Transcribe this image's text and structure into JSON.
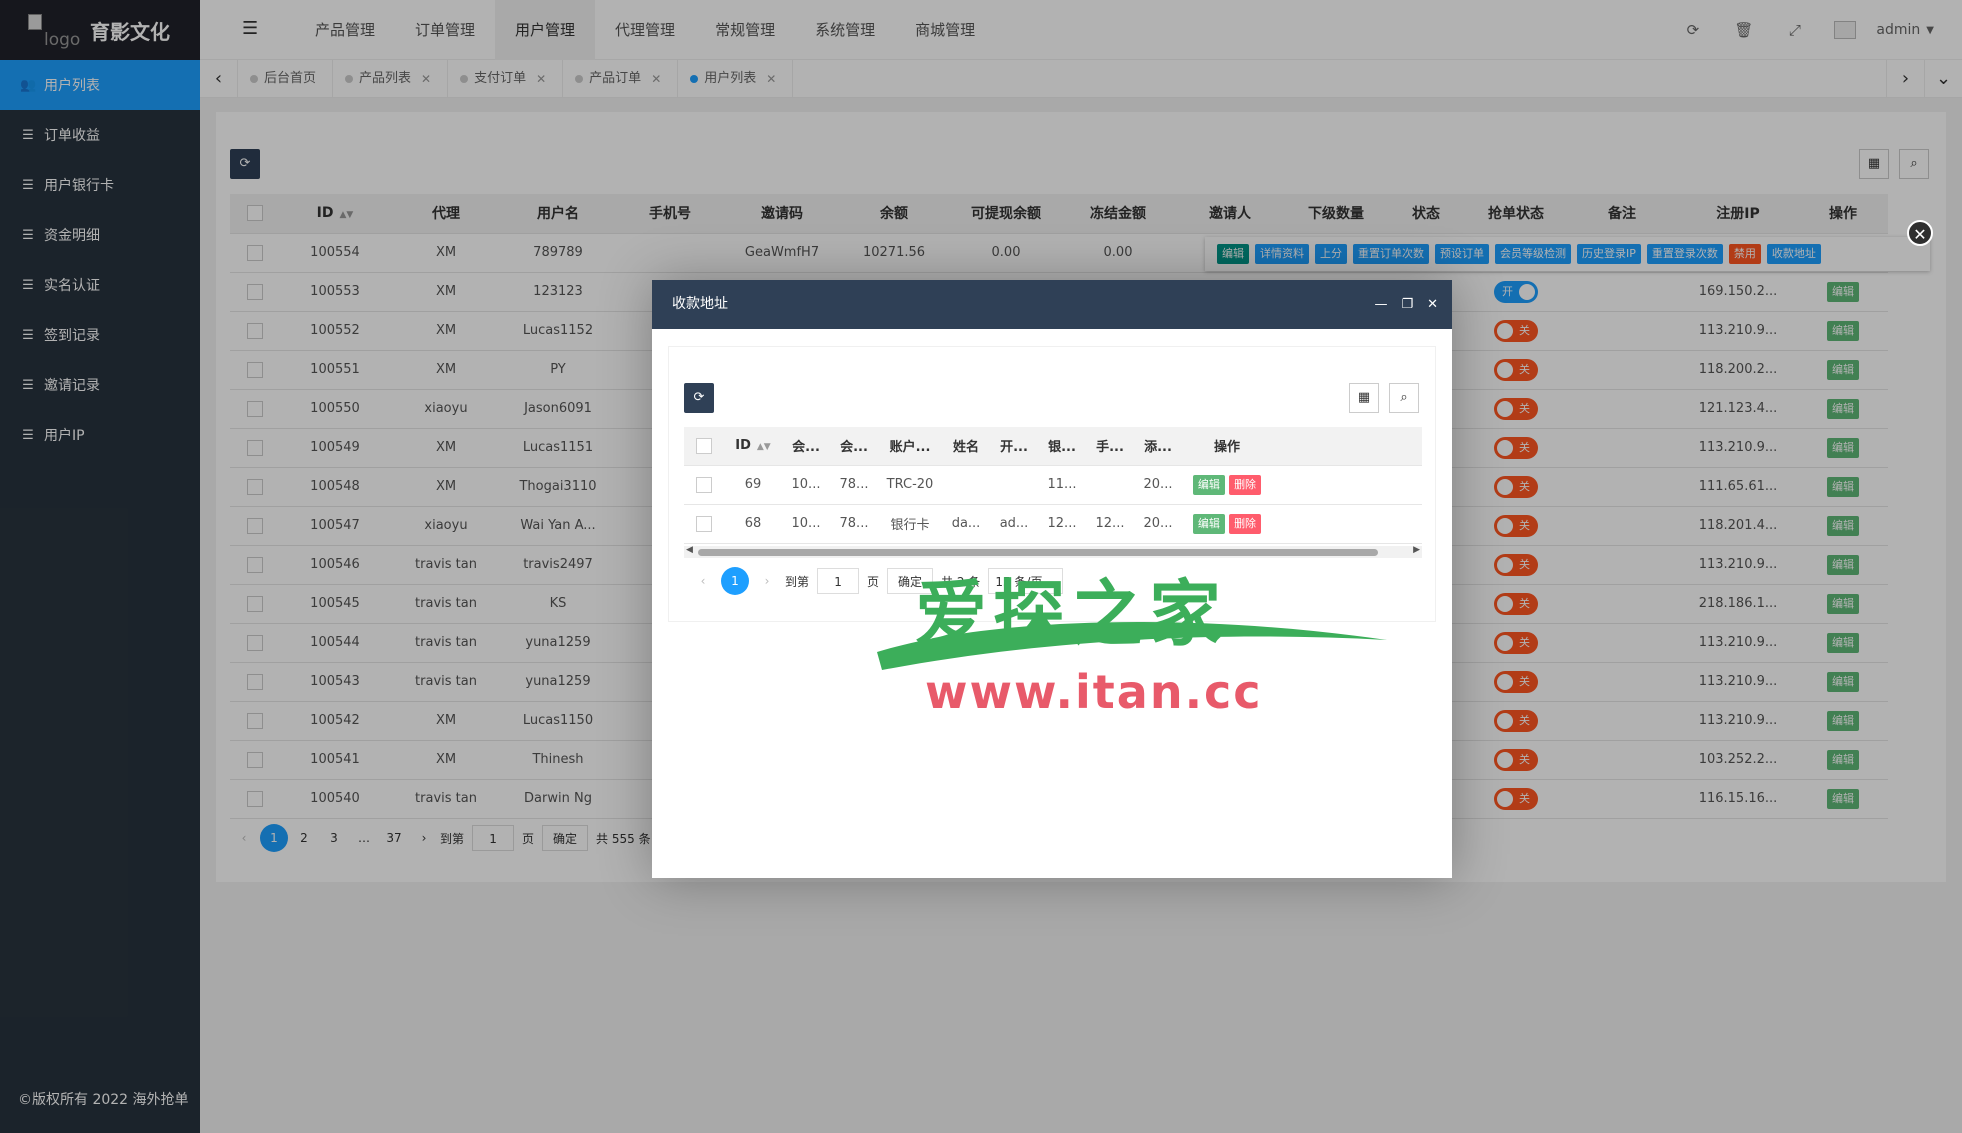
{
  "brand": {
    "logo_alt": "logo",
    "name": "育影文化"
  },
  "sidebar": {
    "items": [
      {
        "label": "用户列表",
        "active": true
      },
      {
        "label": "订单收益"
      },
      {
        "label": "用户银行卡"
      },
      {
        "label": "资金明细"
      },
      {
        "label": "实名认证"
      },
      {
        "label": "签到记录"
      },
      {
        "label": "邀请记录"
      },
      {
        "label": "用户IP"
      }
    ],
    "copyright": "©版权所有 2022 海外抢单"
  },
  "topnav": {
    "items": [
      "产品管理",
      "订单管理",
      "用户管理",
      "代理管理",
      "常规管理",
      "系统管理",
      "商城管理"
    ],
    "active_index": 2,
    "username": "admin"
  },
  "tabs": [
    {
      "label": "后台首页"
    },
    {
      "label": "产品列表"
    },
    {
      "label": "支付订单"
    },
    {
      "label": "产品订单"
    },
    {
      "label": "用户列表",
      "active": true
    }
  ],
  "table": {
    "headers": [
      "ID",
      "代理",
      "用户名",
      "手机号",
      "邀请码",
      "余额",
      "可提现余额",
      "冻结金额",
      "邀请人",
      "下级数量",
      "状态",
      "抢单状态",
      "备注",
      "注册IP",
      "操作"
    ],
    "first_row": {
      "id": "100554",
      "agent": "XM",
      "username": "789789",
      "phone": "",
      "invite_code": "GeaWmfH7",
      "balance": "10271.56",
      "withdrawable": "0.00",
      "frozen": "0.00"
    },
    "rows": [
      {
        "id": "100553",
        "agent": "XM",
        "username": "123123",
        "grab": "开",
        "ip": "169.150.2..."
      },
      {
        "id": "100552",
        "agent": "XM",
        "username": "Lucas1152",
        "grab": "关",
        "ip": "113.210.9..."
      },
      {
        "id": "100551",
        "agent": "XM",
        "username": "PY",
        "grab": "关",
        "ip": "118.200.2..."
      },
      {
        "id": "100550",
        "agent": "xiaoyu",
        "username": "Jason6091",
        "grab": "关",
        "ip": "121.123.4..."
      },
      {
        "id": "100549",
        "agent": "XM",
        "username": "Lucas1151",
        "grab": "关",
        "ip": "113.210.9..."
      },
      {
        "id": "100548",
        "agent": "XM",
        "username": "Thogai3110",
        "grab": "关",
        "ip": "111.65.61..."
      },
      {
        "id": "100547",
        "agent": "xiaoyu",
        "username": "Wai Yan A...",
        "grab": "关",
        "ip": "118.201.4..."
      },
      {
        "id": "100546",
        "agent": "travis tan",
        "username": "travis2497",
        "grab": "关",
        "ip": "113.210.9..."
      },
      {
        "id": "100545",
        "agent": "travis tan",
        "username": "KS",
        "grab": "关",
        "ip": "218.186.1..."
      },
      {
        "id": "100544",
        "agent": "travis tan",
        "username": "yuna1259",
        "grab": "关",
        "ip": "113.210.9..."
      },
      {
        "id": "100543",
        "agent": "travis tan",
        "username": "yuna1259",
        "grab": "关",
        "ip": "113.210.9..."
      },
      {
        "id": "100542",
        "agent": "XM",
        "username": "Lucas1150",
        "grab": "关",
        "ip": "113.210.9..."
      },
      {
        "id": "100541",
        "agent": "XM",
        "username": "Thinesh",
        "grab": "关",
        "ip": "103.252.2..."
      },
      {
        "id": "100540",
        "agent": "travis tan",
        "username": "Darwin Ng",
        "grab": "关",
        "ip": "116.15.16..."
      }
    ],
    "edit_label": "编辑",
    "row_actions": [
      "编辑",
      "详情资料",
      "上分",
      "重置订单次数",
      "预设订单",
      "会员等级检测",
      "历史登录IP",
      "重置登录次数",
      "禁用",
      "收款地址"
    ]
  },
  "pager": {
    "pages": [
      "1",
      "2",
      "3",
      "…",
      "37"
    ],
    "goto_label": "到第",
    "goto_value": "1",
    "page_unit": "页",
    "confirm": "确定",
    "total": "共 555 条"
  },
  "modal": {
    "title": "收款地址",
    "headers": [
      "ID",
      "会...",
      "会...",
      "账户...",
      "姓名",
      "开...",
      "银...",
      "手...",
      "添...",
      "操作"
    ],
    "rows": [
      [
        "69",
        "10...",
        "78...",
        "TRC-20",
        "",
        "",
        "11...",
        "",
        "20..."
      ],
      [
        "68",
        "10...",
        "78...",
        "银行卡",
        "da...",
        "ad...",
        "12...",
        "12...",
        "20..."
      ]
    ],
    "edit_label": "编辑",
    "delete_label": "删除",
    "pager": {
      "current": "1",
      "goto_label": "到第",
      "goto_value": "1",
      "page_unit": "页",
      "confirm": "确定",
      "total": "共 2 条",
      "per_page": "15 条/页"
    }
  },
  "watermark": {
    "title": "爱探之家",
    "url": "www.itan.cc"
  }
}
